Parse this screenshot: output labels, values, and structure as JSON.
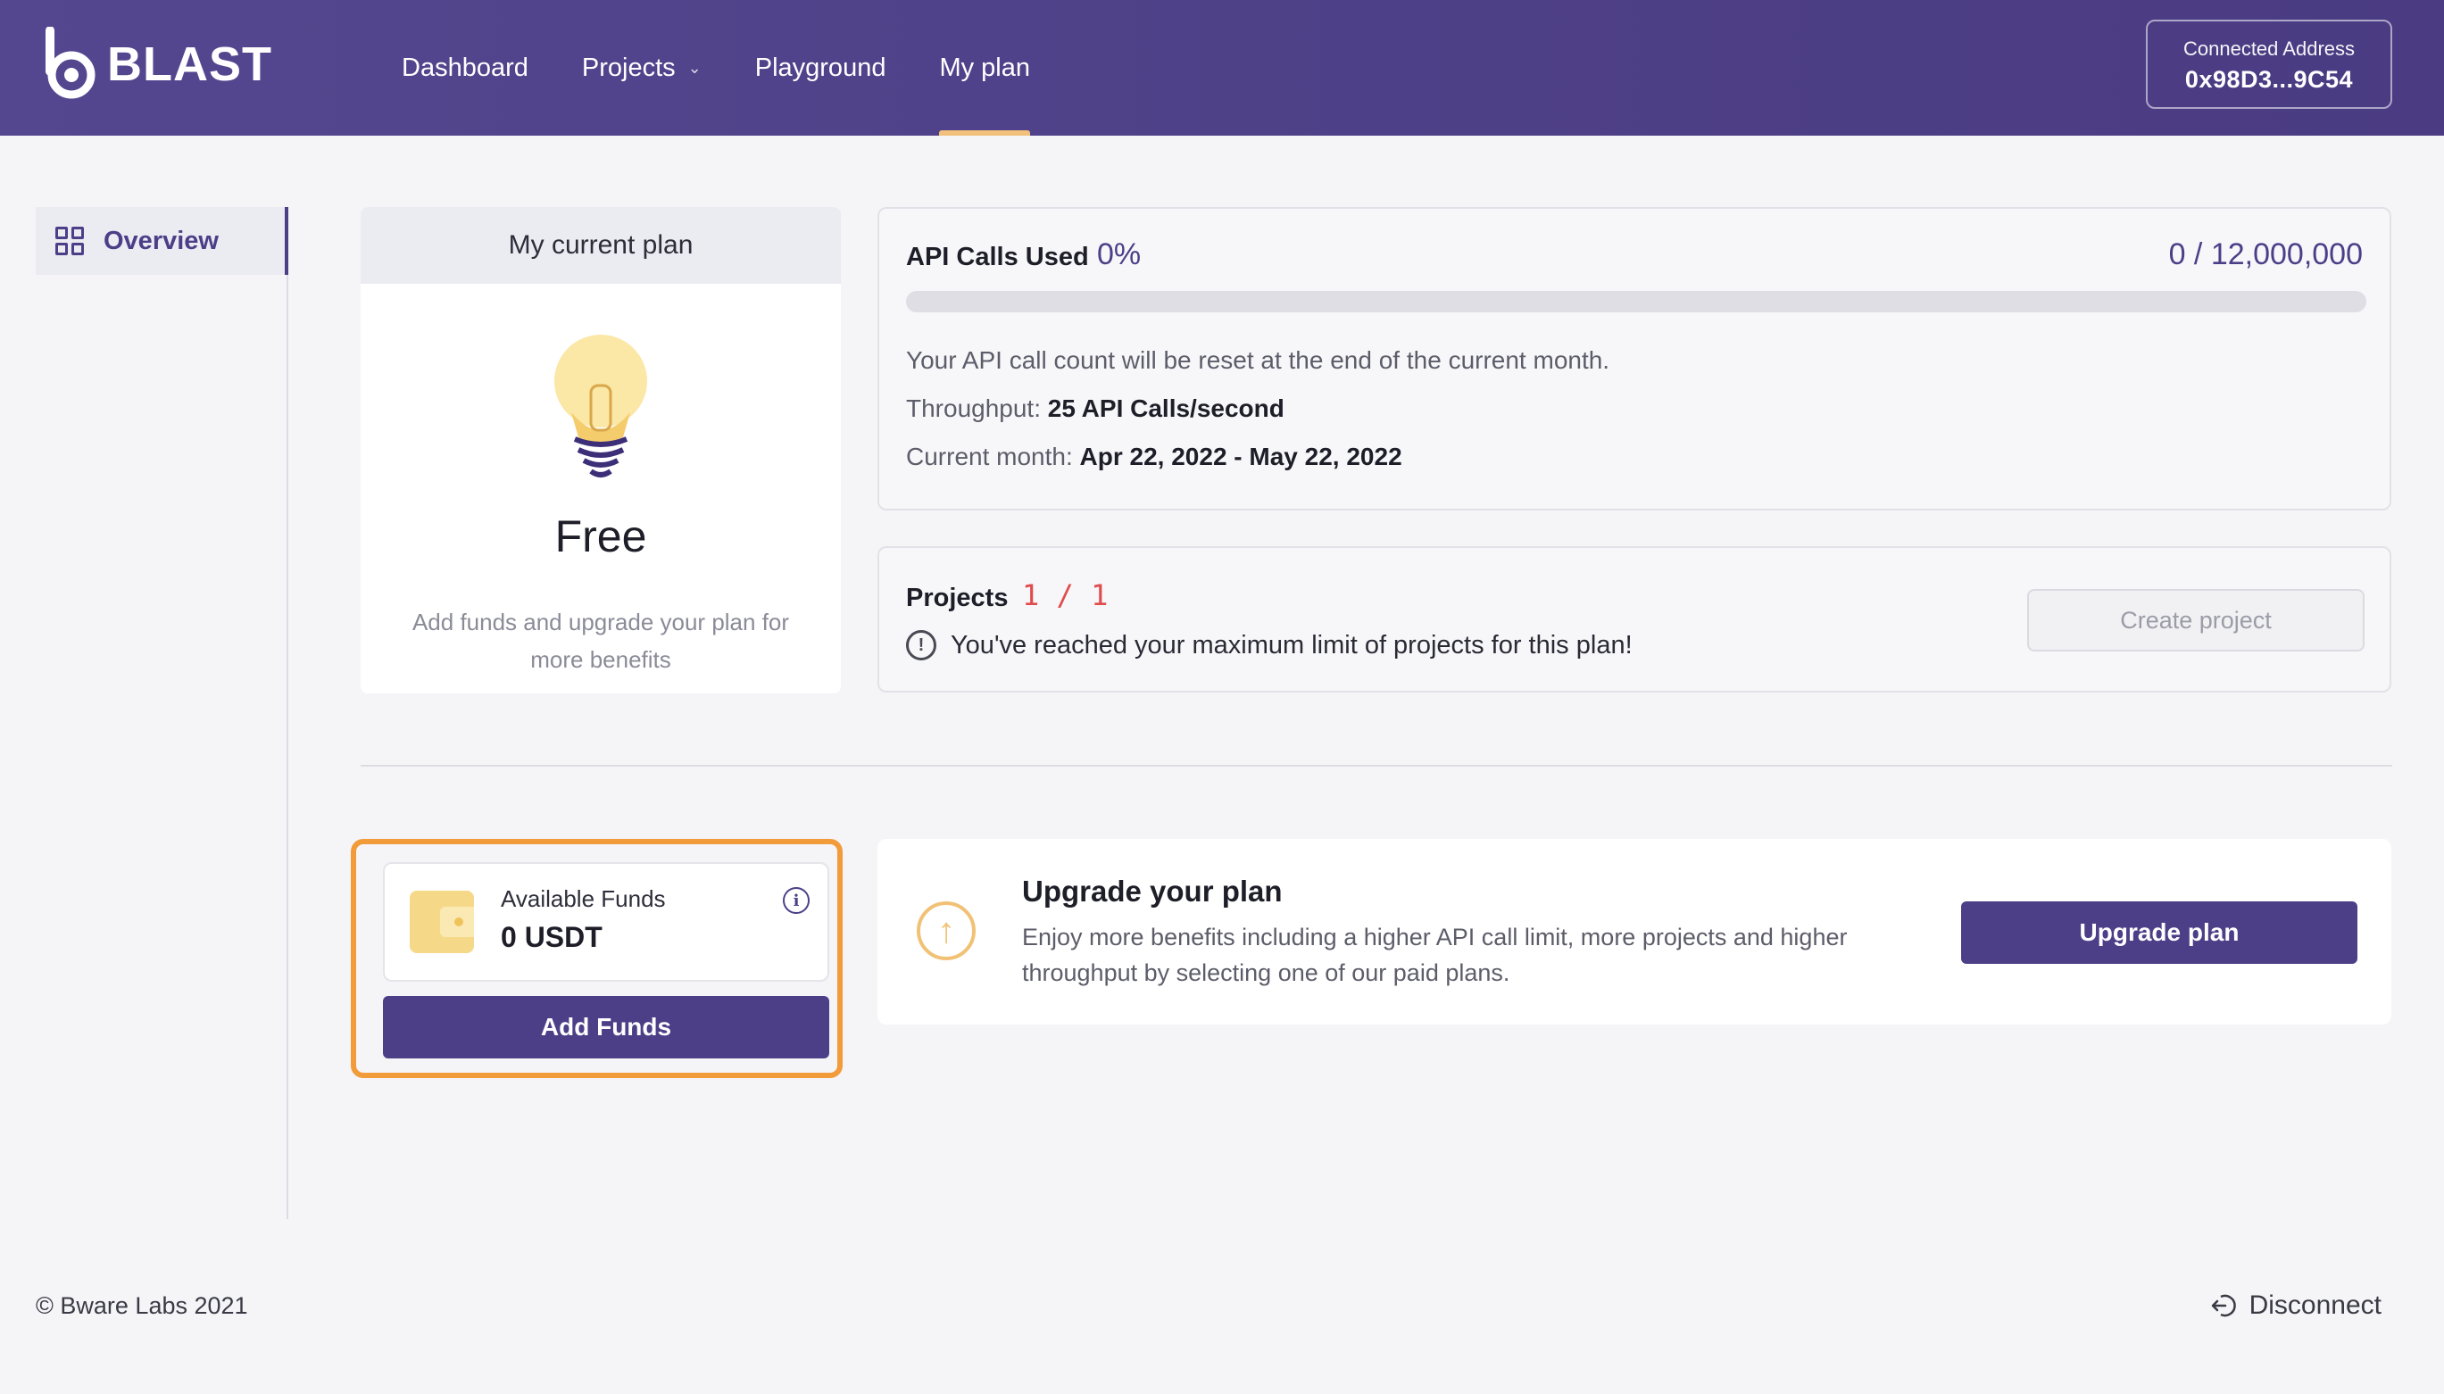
{
  "header": {
    "logo_text": "BLAST",
    "nav": [
      {
        "label": "Dashboard"
      },
      {
        "label": "Projects"
      },
      {
        "label": "Playground"
      },
      {
        "label": "My plan"
      }
    ],
    "active_nav": "My plan",
    "connected_address_label": "Connected Address",
    "connected_address": "0x98D3...9C54"
  },
  "sidebar": {
    "items": [
      {
        "label": "Overview",
        "icon": "grid-icon"
      }
    ]
  },
  "plan": {
    "header": "My current plan",
    "name": "Free",
    "description": "Add funds and upgrade your plan for more benefits",
    "icon": "lightbulb-icon"
  },
  "api": {
    "title": "API Calls Used",
    "percent": "0%",
    "usage_fraction": 0,
    "count": "0 / 12,000,000",
    "reset_note": "Your API call count will be reset at the end of the current month.",
    "throughput_label": "Throughput:",
    "throughput_value": "25 API Calls/second",
    "month_label": "Current month:",
    "month_value": "Apr 22, 2022 - May 22, 2022"
  },
  "projects": {
    "title": "Projects",
    "count": "1 / 1",
    "warning": "You've reached your maximum limit of projects for this plan!",
    "create_label": "Create project"
  },
  "funds": {
    "label": "Available Funds",
    "value": "0 USDT",
    "add_label": "Add Funds"
  },
  "upgrade": {
    "title": "Upgrade your plan",
    "description": "Enjoy more benefits including a higher API call limit, more projects and higher throughput by selecting one of our paid plans.",
    "button_label": "Upgrade plan"
  },
  "footer": {
    "copyright": "© Bware Labs 2021",
    "disconnect_label": "Disconnect"
  },
  "colors": {
    "brand": "#4c3f88",
    "accent": "#f29b3a",
    "warning": "#e04c4c"
  }
}
